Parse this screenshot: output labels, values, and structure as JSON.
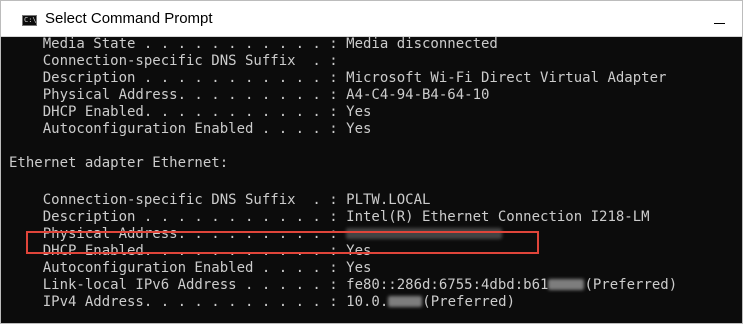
{
  "window": {
    "title": "Select Command Prompt",
    "icon": "cmd-icon",
    "icon_text": "C:\\"
  },
  "console": {
    "lines": [
      {
        "text": "    Media State . . . . . . . . . . . : Media disconnected"
      },
      {
        "text": "    Connection-specific DNS Suffix  . :"
      },
      {
        "text": "    Description . . . . . . . . . . . : Microsoft Wi-Fi Direct Virtual Adapter"
      },
      {
        "text": "    Physical Address. . . . . . . . . : A4-C4-94-B4-64-10"
      },
      {
        "text": "    DHCP Enabled. . . . . . . . . . . : Yes"
      },
      {
        "text": "    Autoconfiguration Enabled . . . . : Yes"
      },
      {
        "text": ""
      },
      {
        "text": "Ethernet adapter Ethernet:"
      },
      {
        "text": ""
      },
      {
        "text": "    Connection-specific DNS Suffix  . : PLTW.LOCAL"
      },
      {
        "text": "    Description . . . . . . . . . . . : Intel(R) Ethernet Connection I218-LM"
      },
      {
        "text": "    Physical Address. . . . . . . . . : "
      },
      {
        "text": "    DHCP Enabled. . . . . . . . . . . : Yes"
      },
      {
        "text": "    Autoconfiguration Enabled . . . . : Yes"
      },
      {
        "text": "    Link-local IPv6 Address . . . . . : fe80::286d:6755:4dbd:b61",
        "suffix": "(Preferred)"
      },
      {
        "text": "    IPv4 Address. . . . . . . . . . . : 10.0.",
        "suffix": "(Preferred)"
      }
    ]
  },
  "colors": {
    "console_bg": "#0c0c0c",
    "console_text": "#cccccc",
    "highlight_border": "#e0453a"
  }
}
